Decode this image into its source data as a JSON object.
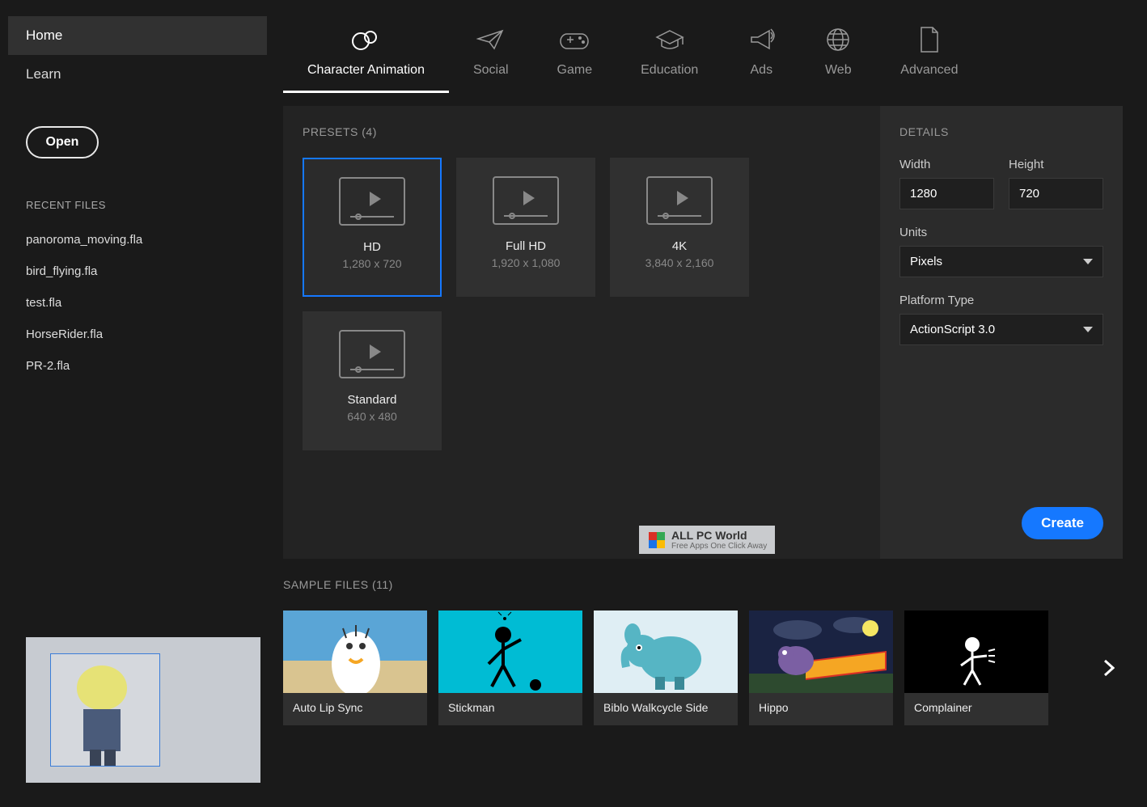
{
  "sidebar": {
    "nav": [
      {
        "label": "Home"
      },
      {
        "label": "Learn"
      }
    ],
    "open_label": "Open",
    "recent_label": "RECENT FILES",
    "recent": [
      "panoroma_moving.fla",
      "bird_flying.fla",
      "test.fla",
      "HorseRider.fla",
      "PR-2.fla"
    ]
  },
  "tabs": [
    {
      "label": "Character Animation"
    },
    {
      "label": "Social"
    },
    {
      "label": "Game"
    },
    {
      "label": "Education"
    },
    {
      "label": "Ads"
    },
    {
      "label": "Web"
    },
    {
      "label": "Advanced"
    }
  ],
  "presets": {
    "header": "PRESETS (4)",
    "items": [
      {
        "name": "HD",
        "dim": "1,280 x 720"
      },
      {
        "name": "Full HD",
        "dim": "1,920 x 1,080"
      },
      {
        "name": "4K",
        "dim": "3,840 x 2,160"
      },
      {
        "name": "Standard",
        "dim": "640 x 480"
      }
    ]
  },
  "details": {
    "header": "DETAILS",
    "width_label": "Width",
    "width_value": "1280",
    "height_label": "Height",
    "height_value": "720",
    "units_label": "Units",
    "units_value": "Pixels",
    "platform_label": "Platform Type",
    "platform_value": "ActionScript 3.0",
    "create_label": "Create"
  },
  "watermark": {
    "title": "ALL PC World",
    "sub": "Free Apps One Click Away"
  },
  "samples": {
    "header": "SAMPLE FILES (11)",
    "items": [
      "Auto Lip Sync",
      "Stickman",
      "Biblo Walkcycle Side",
      "Hippo",
      "Complainer"
    ]
  }
}
